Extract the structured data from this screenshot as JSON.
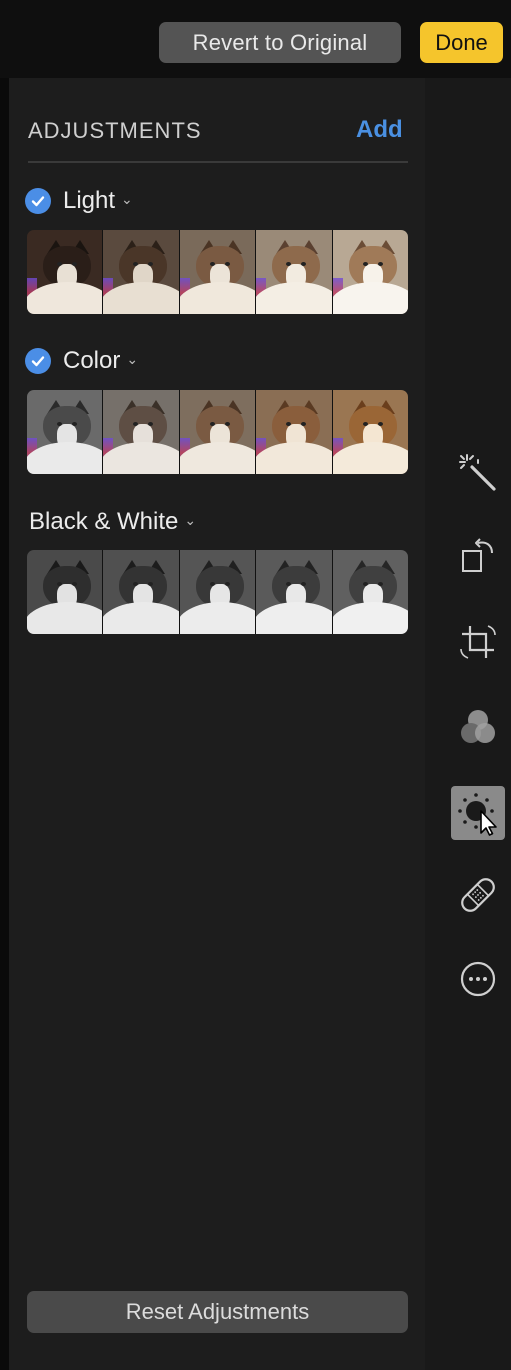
{
  "topbar": {
    "revert_label": "Revert to Original",
    "done_label": "Done"
  },
  "adjustments": {
    "header": "ADJUSTMENTS",
    "add_label": "Add",
    "sections": [
      {
        "title": "Light",
        "checked": true,
        "tint": "warm"
      },
      {
        "title": "Color",
        "checked": true,
        "tint": "desat-to-color"
      },
      {
        "title": "Black & White",
        "checked": false,
        "tint": "mono"
      }
    ],
    "reset_label": "Reset Adjustments"
  },
  "toolbar": {
    "tools": [
      {
        "icon": "magic-wand-icon",
        "active": false
      },
      {
        "icon": "rotate-icon",
        "active": false
      },
      {
        "icon": "crop-icon",
        "active": false
      },
      {
        "icon": "filters-icon",
        "active": false
      },
      {
        "icon": "adjust-icon",
        "active": true
      },
      {
        "icon": "retouch-bandage-icon",
        "active": false
      },
      {
        "icon": "more-icon",
        "active": false
      }
    ]
  },
  "colors": {
    "accent_blue": "#4a90e2",
    "done_yellow": "#f5c52c",
    "panel_bg": "#1d1d1d"
  }
}
